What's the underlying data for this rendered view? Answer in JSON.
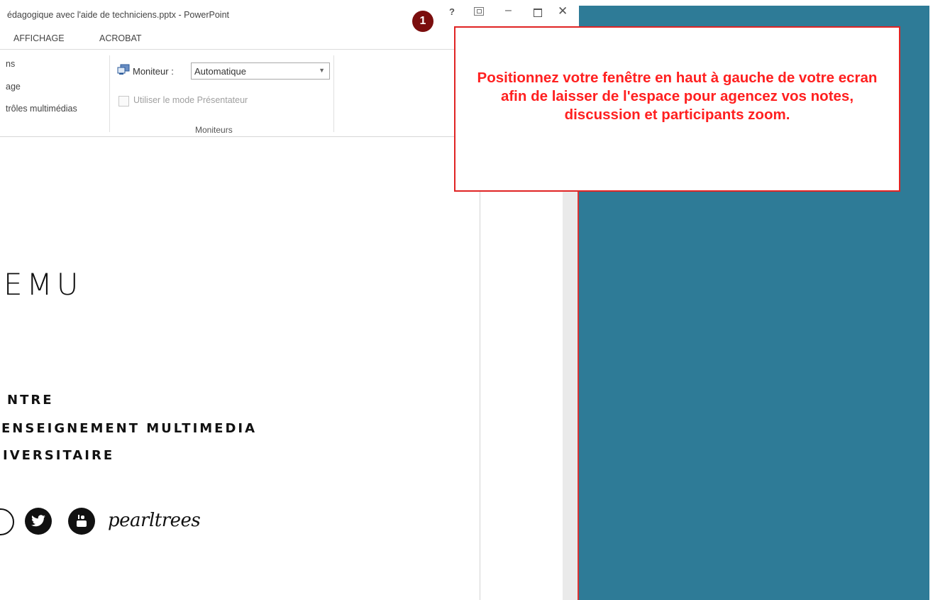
{
  "window": {
    "title": "édagogique avec l'aide de techniciens.pptx - PowerPoint",
    "help_label": "?",
    "minimize_label": "–",
    "close_label": "✕"
  },
  "badge": {
    "number": "1"
  },
  "tabs": [
    "AFFICHAGE",
    "ACROBAT"
  ],
  "ribbon": {
    "left_items": [
      "ns",
      "age",
      "trôles multimédias"
    ],
    "monitor_label": "Moniteur :",
    "monitor_value": "Automatique",
    "presenter_label": "Utiliser le mode Présentateur",
    "group_label": "Moniteurs"
  },
  "slide": {
    "logo": "EMU",
    "lines": [
      "NTRE",
      "ENSEIGNEMENT MULTIMEDIA",
      "IVERSITAIRE"
    ],
    "brand": "pearltrees"
  },
  "callout": {
    "text": "Positionnez votre fenêtre en haut à gauche de votre ecran afin de laisser de l'espace pour agencez vos notes, discussion et participants zoom."
  },
  "colors": {
    "teal": "#2e7b97",
    "callout_border": "#e02424",
    "callout_text": "#ff2020",
    "badge": "#7b0e0e"
  },
  "icons": [
    "help-icon",
    "ribbon-display-icon",
    "minimize-icon",
    "maximize-icon",
    "close-icon",
    "monitor-icon",
    "dropdown-arrow-icon",
    "twitter-icon",
    "youtube-icon"
  ]
}
